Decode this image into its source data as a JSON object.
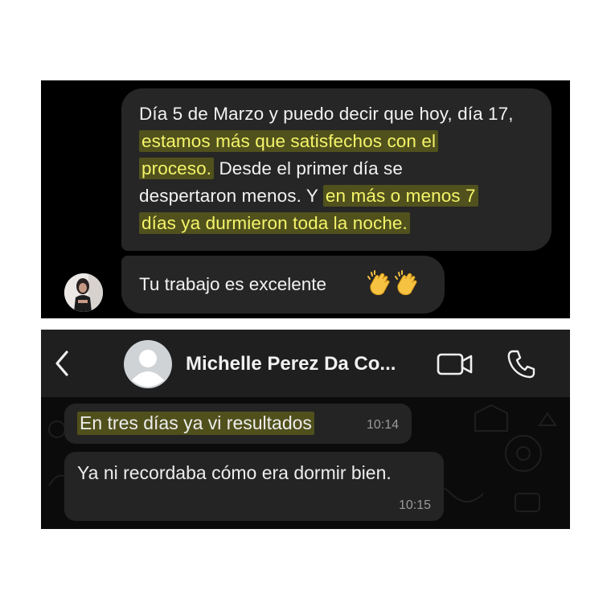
{
  "panel_top": {
    "message_1_lines": [
      {
        "plain": "Día 5 de Marzo y puedo decir que hoy, día 17,",
        "highlight": ""
      },
      {
        "plain": "",
        "highlight": "estamos más que satisfechos con el"
      },
      {
        "highlight": "proceso.",
        "plain": " Desde el primer día se"
      },
      {
        "plain": "despertaron menos. Y ",
        "highlight": "en más o menos 7"
      },
      {
        "plain": "",
        "highlight": "días ya durmieron toda la noche."
      }
    ],
    "message_2": "Tu trabajo es excelente",
    "message_2_emoji": [
      "clapping-hands",
      "clapping-hands"
    ],
    "highlight_color": "#f4f46a",
    "bubble_color": "#262626"
  },
  "panel_bottom": {
    "header": {
      "contact_name": "Michelle Perez Da Co...",
      "icons": [
        "back-chevron-icon",
        "default-avatar-icon",
        "video-call-icon",
        "voice-call-icon"
      ]
    },
    "messages": [
      {
        "text": "En tres días ya vi resultados",
        "time": "10:14",
        "highlighted": true
      },
      {
        "text": "Ya ni recordaba cómo era dormir bien.",
        "time": "10:15",
        "highlighted": false
      }
    ]
  }
}
